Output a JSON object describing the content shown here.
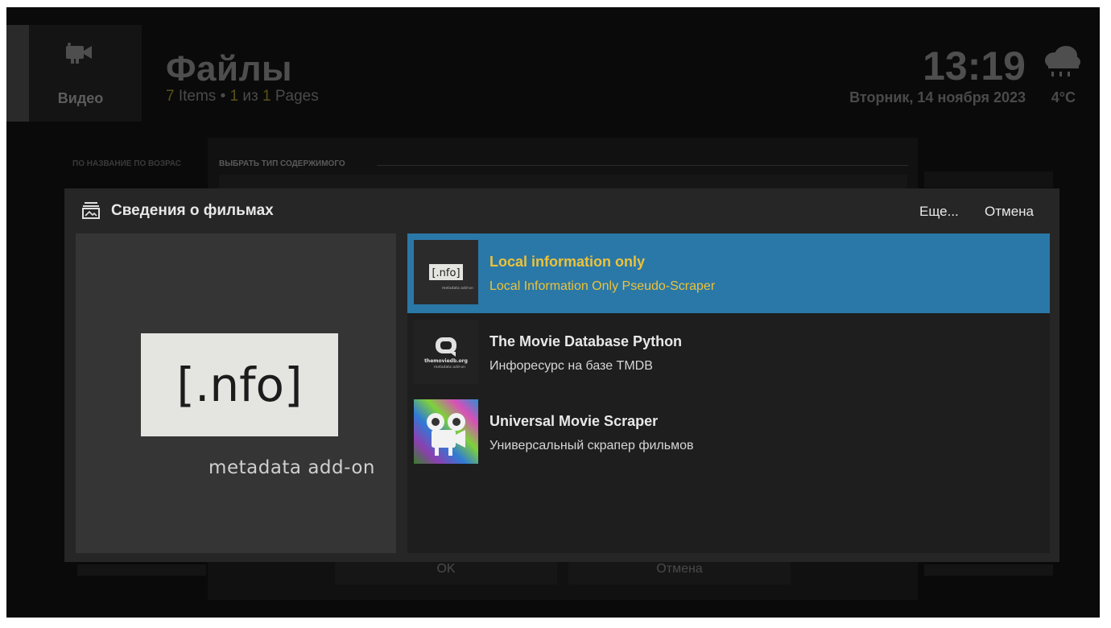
{
  "background": {
    "section_label": "Видео",
    "title": "Файлы",
    "items_count": "7",
    "items_word": "Items",
    "separator": "•",
    "page_current": "1",
    "page_of": "из",
    "page_total": "1",
    "pages_word": "Pages",
    "clock": "13:19",
    "date": "Вторник, 14 ноября 2023",
    "temperature": "4°C",
    "sort_labels": "ПО НАЗВАНИЕ  ПО ВОЗРАС",
    "inner_dialog_heading": "ВЫБРАТЬ ТИП СОДЕРЖИМОГО",
    "ok_label": "OK",
    "cancel_label": "Отмена"
  },
  "dialog": {
    "title": "Сведения о фильмах",
    "more_label": "Еще...",
    "cancel_label": "Отмена",
    "preview": {
      "logo_text": "[.nfo]",
      "caption": "metadata add-on"
    },
    "items": [
      {
        "title": "Local information only",
        "subtitle": "Local Information Only Pseudo-Scraper",
        "thumb_text": "[.nfo]",
        "thumb_caption": "metadata add-on",
        "selected": true
      },
      {
        "title": "The Movie Database Python",
        "subtitle": "Инфоресурс на базе TMDB",
        "thumb_text": "themoviedb.org",
        "thumb_caption": "metadata add-on",
        "selected": false
      },
      {
        "title": "Universal Movie Scraper",
        "subtitle": "Универсальный скрапер фильмов",
        "selected": false
      }
    ]
  },
  "colors": {
    "selected_bg": "#2a78a8",
    "selected_text": "#ecc23a",
    "dialog_bg": "#262626"
  }
}
